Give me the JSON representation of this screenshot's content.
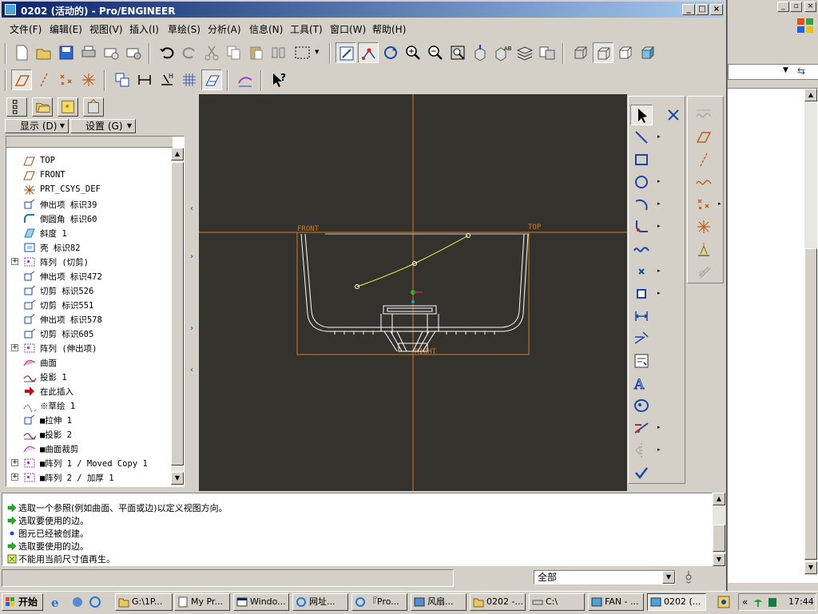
{
  "window": {
    "title": "0202 (活动的) - Pro/ENGINEER",
    "controls": {
      "minimize": "_",
      "maximize": "□",
      "close": "×"
    }
  },
  "menu": [
    {
      "label": "文件(F)"
    },
    {
      "label": "编辑(E)"
    },
    {
      "label": "视图(V)"
    },
    {
      "label": "插入(I)"
    },
    {
      "label": "草绘(S)"
    },
    {
      "label": "分析(A)"
    },
    {
      "label": "信息(N)"
    },
    {
      "label": "工具(T)"
    },
    {
      "label": "窗口(W)"
    },
    {
      "label": "帮助(H)"
    }
  ],
  "navigator": {
    "display_menu": "显示",
    "display_key": "D",
    "settings_menu": "设置",
    "settings_key": "G"
  },
  "model_tree": [
    {
      "label": "TOP",
      "icon": "datum-plane-icon",
      "expand": ""
    },
    {
      "label": "FRONT",
      "icon": "datum-plane-icon",
      "expand": ""
    },
    {
      "label": "PRT_CSYS_DEF",
      "icon": "csys-icon",
      "expand": ""
    },
    {
      "label": "伸出项 标识39",
      "icon": "protrusion-icon",
      "expand": ""
    },
    {
      "label": "倒圆角 标识60",
      "icon": "round-icon",
      "expand": ""
    },
    {
      "label": "斜度 1",
      "icon": "draft-icon",
      "expand": ""
    },
    {
      "label": "壳 标识82",
      "icon": "shell-icon",
      "expand": ""
    },
    {
      "label": "阵列 (切剪)",
      "icon": "pattern-icon",
      "expand": "+"
    },
    {
      "label": "伸出项 标识472",
      "icon": "protrusion-icon",
      "expand": ""
    },
    {
      "label": "切剪 标识526",
      "icon": "cut-icon",
      "expand": ""
    },
    {
      "label": "切剪 标识551",
      "icon": "cut-icon",
      "expand": ""
    },
    {
      "label": "伸出项 标识578",
      "icon": "protrusion-icon",
      "expand": ""
    },
    {
      "label": "切剪 标识605",
      "icon": "cut-icon",
      "expand": ""
    },
    {
      "label": "阵列 (伸出项)",
      "icon": "pattern-icon",
      "expand": "+"
    },
    {
      "label": "曲面",
      "icon": "surface-icon",
      "expand": ""
    },
    {
      "label": "投影 1",
      "icon": "projection-icon",
      "expand": ""
    },
    {
      "label": "在此插入",
      "icon": "insert-here-arrow-icon",
      "expand": ""
    },
    {
      "label": "※草绘 1",
      "icon": "sketch-icon",
      "expand": ""
    },
    {
      "label": "■拉伸 1",
      "icon": "extrude-icon",
      "expand": ""
    },
    {
      "label": "■投影 2",
      "icon": "projection-icon",
      "expand": ""
    },
    {
      "label": "■曲面裁剪",
      "icon": "surface-trim-icon",
      "expand": ""
    },
    {
      "label": "■阵列 1 / Moved Copy 1",
      "icon": "pattern-icon",
      "expand": "+"
    },
    {
      "label": "■阵列 2 / 加厚 1",
      "icon": "pattern-icon",
      "expand": "+"
    }
  ],
  "viewport": {
    "datum_labels": {
      "front": "FRONT",
      "top": "TOP",
      "right": "RIGHT"
    },
    "colors": {
      "background": "#34322c",
      "datum": "#d07828",
      "geometry": "#ffffff",
      "sketch": "#ffff50"
    }
  },
  "messages": [
    {
      "text": "选取一个参照(例如曲面、平面或边)以定义视图方向。",
      "icon": "prompt-arrow-icon"
    },
    {
      "text": "选取要使用的边。",
      "icon": "prompt-arrow-icon"
    },
    {
      "text": "图元已经被创建。",
      "icon": "info-dot-icon"
    },
    {
      "text": "选取要使用的边。",
      "icon": "prompt-arrow-icon"
    },
    {
      "text": "不能用当前尺寸值再生。",
      "icon": "warning-icon"
    }
  ],
  "status": {
    "filter": "全部"
  },
  "taskbar": {
    "start": "开始",
    "items": [
      {
        "label": "G:\\1P..."
      },
      {
        "label": "My Pr..."
      },
      {
        "label": "Windo..."
      },
      {
        "label": "网址..."
      },
      {
        "label": "『Pro..."
      },
      {
        "label": "风扇..."
      },
      {
        "label": "0202 -..."
      },
      {
        "label": "C:\\"
      },
      {
        "label": "FAN - ..."
      },
      {
        "label": "0202 (..."
      }
    ],
    "clock": "17:44"
  }
}
